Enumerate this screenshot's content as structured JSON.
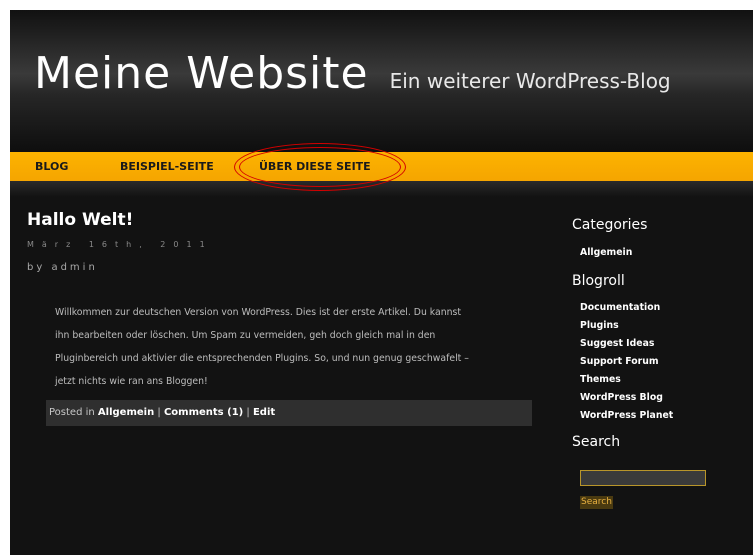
{
  "site": {
    "title": "Meine Website",
    "tagline": "Ein weiterer WordPress-Blog"
  },
  "nav": {
    "items": [
      "BLOG",
      "BEISPIEL-SEITE",
      "ÜBER DIESE SEITE"
    ]
  },
  "post": {
    "title": "Hallo Welt!",
    "date": "März 16th, 2011",
    "author": "by admin",
    "body": [
      "Willkommen zur deutschen Version von WordPress. Dies ist der erste Artikel. Du kannst",
      "ihn bearbeiten oder löschen. Um Spam zu vermeiden, geh doch gleich mal in den",
      "Pluginbereich und aktivier die entsprechenden Plugins. So, und nun genug geschwafelt –",
      "jetzt nichts wie ran ans Bloggen!"
    ],
    "footer": {
      "posted_in": "Posted in",
      "category": "Allgemein",
      "sep1": "|",
      "comments": "Comments (1)",
      "sep2": "|",
      "edit": "Edit"
    }
  },
  "sidebar": {
    "categories_heading": "Categories",
    "categories": [
      "Allgemein"
    ],
    "blogroll_heading": "Blogroll",
    "blogroll": [
      "Documentation",
      "Plugins",
      "Suggest Ideas",
      "Support Forum",
      "Themes",
      "WordPress Blog",
      "WordPress Planet"
    ],
    "search_heading": "Search",
    "search_value": "",
    "search_button": "Search"
  },
  "colors": {
    "nav_bar": "#fdb300",
    "annotation_oval": "#d40000",
    "background": "#121212"
  }
}
